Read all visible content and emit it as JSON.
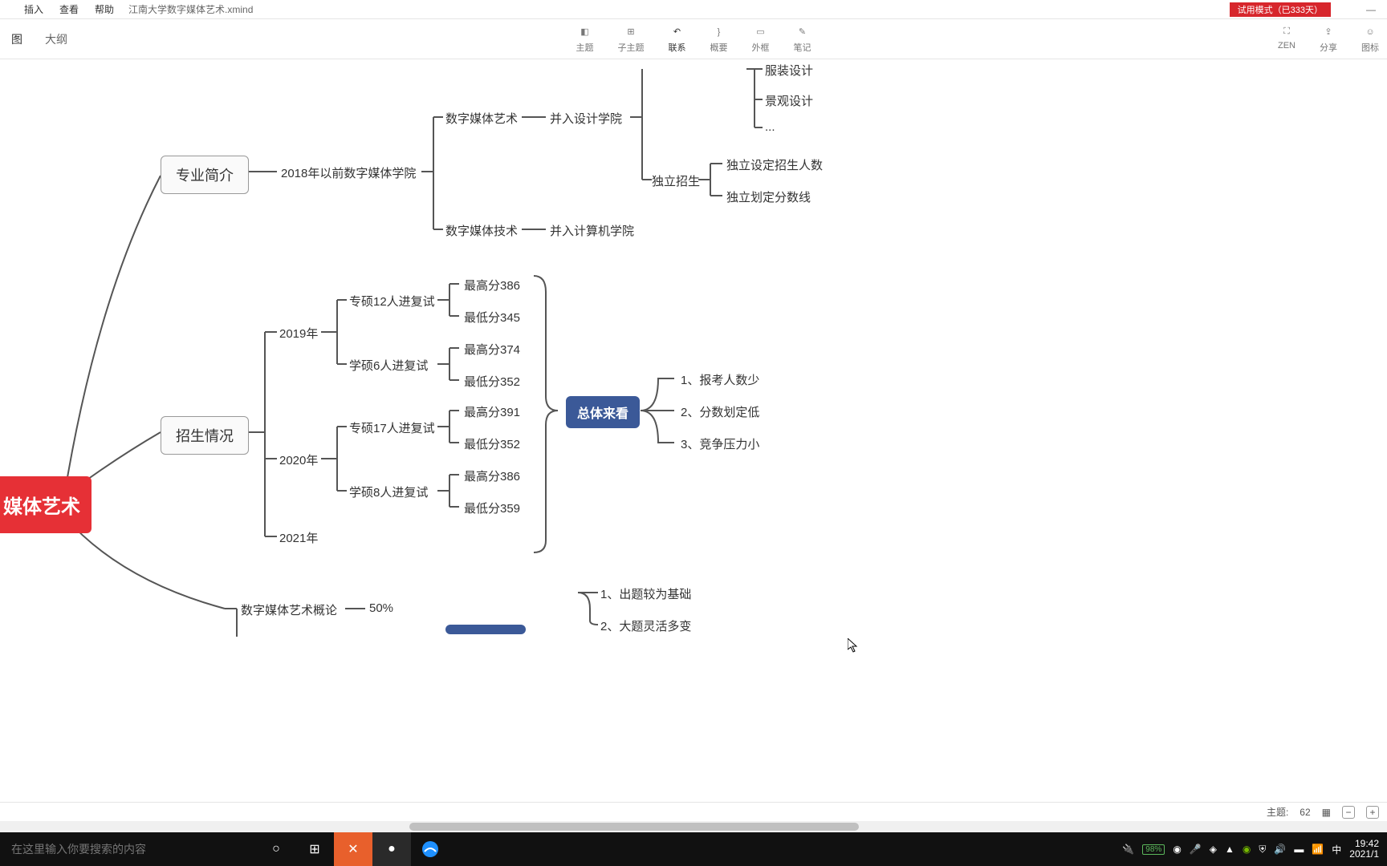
{
  "menubar": {
    "items": [
      "",
      "插入",
      "查看",
      "帮助"
    ],
    "filename": "江南大学数字媒体艺术.xmind",
    "trial": "试用模式（已333天）"
  },
  "tabs": {
    "left": [
      "图",
      "大纲"
    ],
    "tools": [
      {
        "label": "主题",
        "icon": "topic"
      },
      {
        "label": "子主题",
        "icon": "subtopic"
      },
      {
        "label": "联系",
        "icon": "relation",
        "active": true
      },
      {
        "label": "概要",
        "icon": "summary"
      },
      {
        "label": "外框",
        "icon": "boundary"
      },
      {
        "label": "笔记",
        "icon": "note"
      }
    ],
    "right": [
      {
        "label": "ZEN",
        "icon": "zen"
      },
      {
        "label": "分享",
        "icon": "share"
      },
      {
        "label": "图标",
        "icon": "icons"
      }
    ]
  },
  "mindmap": {
    "root": "媒体艺术",
    "n1": "专业简介",
    "n1a": "2018年以前数字媒体学院",
    "n1b1": "数字媒体艺术",
    "n1b1a": "并入设计学院",
    "n1b2": "数字媒体技术",
    "n1b2a": "并入计算机学院",
    "n1c1": "服装设计",
    "n1c2": "景观设计",
    "n1c3": "...",
    "n1d": "独立招生",
    "n1d1": "独立设定招生人数",
    "n1d2": "独立划定分数线",
    "n2": "招生情况",
    "y19": "2019年",
    "y20": "2020年",
    "y21": "2021年",
    "y19a": "专硕12人进复试",
    "y19b": "学硕6人进复试",
    "y19a1": "最高分386",
    "y19a2": "最低分345",
    "y19b1": "最高分374",
    "y19b2": "最低分352",
    "y20a": "专硕17人进复试",
    "y20b": "学硕8人进复试",
    "y20a1": "最高分391",
    "y20a2": "最低分352",
    "y20b1": "最高分386",
    "y20b2": "最低分359",
    "summary": "总体来看",
    "s1": "1、报考人数少",
    "s2": "2、分数划定低",
    "s3": "3、竞争压力小",
    "n3a": "数字媒体艺术概论",
    "n3a_pct": "50%",
    "p1": "1、出题较为基础",
    "p2": "2、大题灵活多变"
  },
  "status": {
    "topics_label": "主题:",
    "topics": "62"
  },
  "taskbar": {
    "search_placeholder": "在这里输入你要搜索的内容",
    "battery": "98%",
    "ime": "中",
    "time": "19:42",
    "date": "2021/1"
  }
}
